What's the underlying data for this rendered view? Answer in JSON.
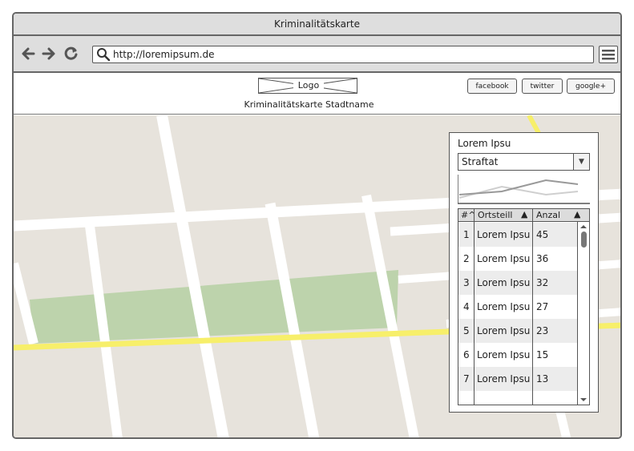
{
  "window": {
    "title": "Kriminalitätskarte"
  },
  "browser": {
    "url": "http://loremipsum.de",
    "back_icon": "arrow-left-icon",
    "forward_icon": "arrow-right-icon",
    "reload_icon": "reload-icon",
    "menu_icon": "hamburger-menu-icon"
  },
  "header": {
    "logo": "Logo",
    "subtitle": "Kriminalitätskarte Stadtname",
    "social": [
      "facebook",
      "twitter",
      "google+"
    ]
  },
  "panel": {
    "title": "Lorem Ipsu",
    "select_value": "Straftat",
    "table": {
      "columns": [
        "#^",
        "Ortsteill",
        "Anzal"
      ],
      "sort_indicators": [
        "▲",
        "▲"
      ],
      "rows": [
        [
          "1",
          "Lorem Ipsu",
          "45"
        ],
        [
          "2",
          "Lorem Ipsu",
          "36"
        ],
        [
          "3",
          "Lorem Ipsu",
          "32"
        ],
        [
          "4",
          "Lorem Ipsu",
          "27"
        ],
        [
          "5",
          "Lorem Ipsu",
          "23"
        ],
        [
          "6",
          "Lorem Ipsu",
          "15"
        ],
        [
          "7",
          "Lorem Ipsu",
          "13"
        ]
      ]
    }
  },
  "colors": {
    "map_background": "#e7e3dc",
    "map_road": "#ffffff",
    "map_highway": "#f7ef6a",
    "map_park": "#bdd3ac",
    "row_alt": "#ececec"
  }
}
